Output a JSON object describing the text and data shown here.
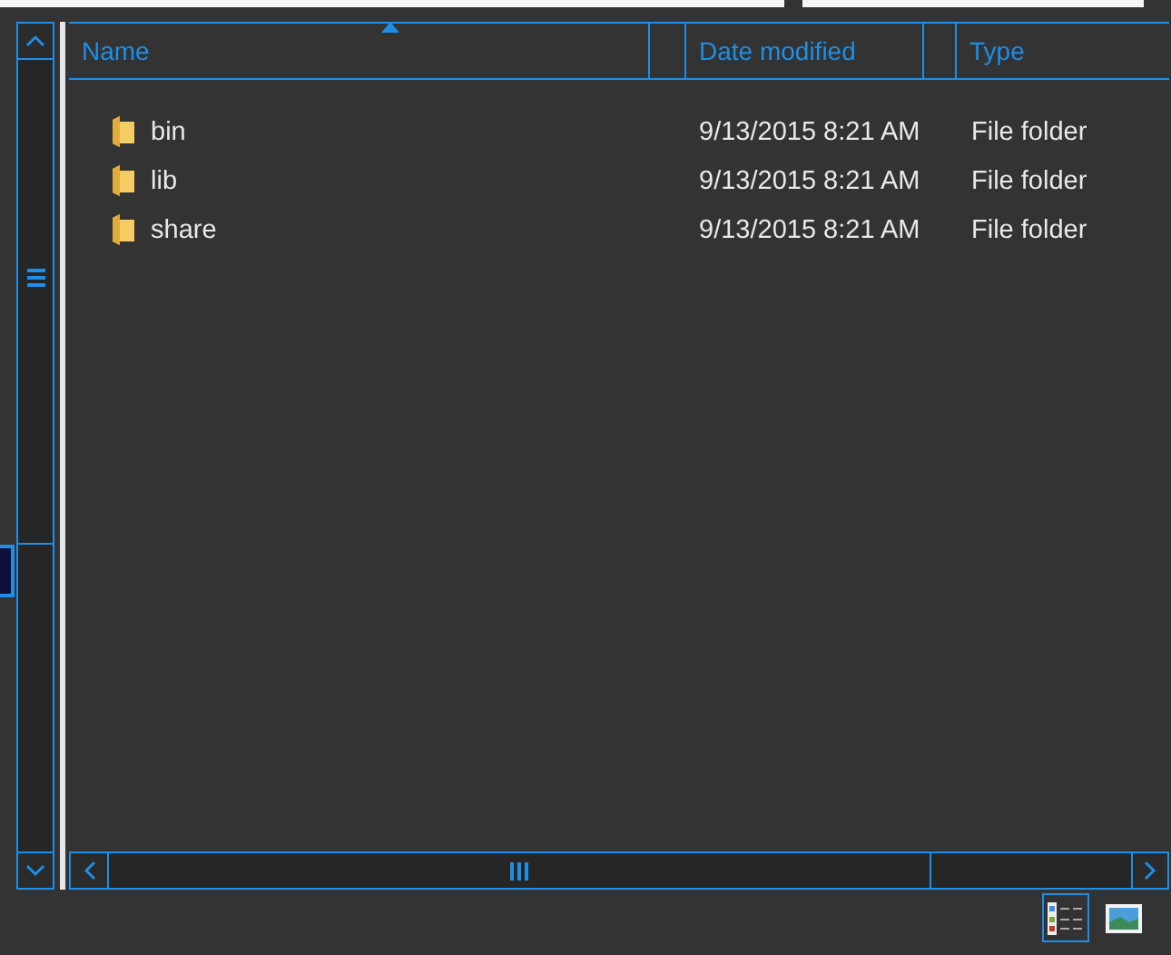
{
  "columns": [
    {
      "label": "Name",
      "sorted": true
    },
    {
      "label": "Date modified",
      "sorted": false
    },
    {
      "label": "Type",
      "sorted": false
    }
  ],
  "rows": [
    {
      "name": "bin",
      "date": "9/13/2015 8:21 AM",
      "type": "File folder"
    },
    {
      "name": "lib",
      "date": "9/13/2015 8:21 AM",
      "type": "File folder"
    },
    {
      "name": "share",
      "date": "9/13/2015 8:21 AM",
      "type": "File folder"
    }
  ],
  "views": [
    {
      "kind": "details",
      "selected": true
    },
    {
      "kind": "preview",
      "selected": false
    }
  ]
}
